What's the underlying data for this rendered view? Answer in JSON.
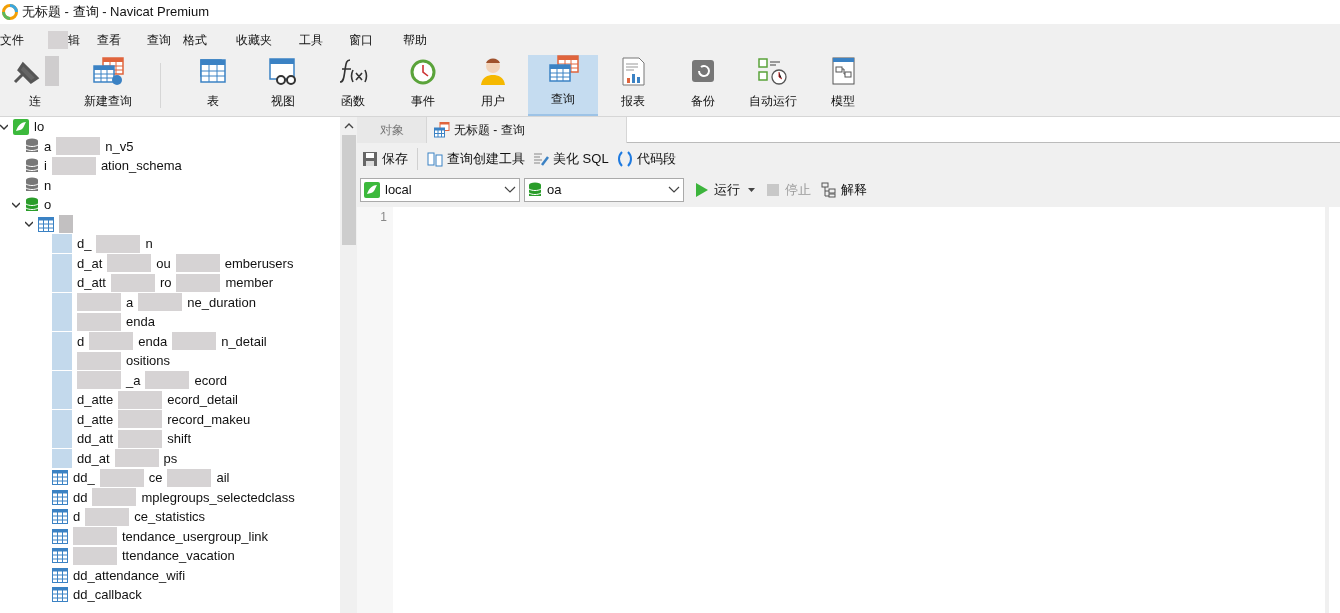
{
  "window": {
    "title": "无标题 - 查询 - Navicat Premium"
  },
  "menu": [
    {
      "parts": [
        "文件"
      ],
      "lead_mask": false
    },
    {
      "parts": [
        "辑"
      ],
      "lead_mask": true
    },
    {
      "parts": [
        "查看"
      ],
      "lead_mask": false
    },
    {
      "parts": [
        "查询"
      ],
      "lead_mask": false
    },
    {
      "parts": [
        "格式"
      ],
      "lead_mask": false
    },
    {
      "parts": [
        "收藏夹"
      ],
      "lead_mask": false
    },
    {
      "parts": [
        "工具"
      ],
      "lead_mask": false
    },
    {
      "parts": [
        "窗口"
      ],
      "lead_mask": false
    },
    {
      "parts": [
        "帮助"
      ],
      "lead_mask": false
    }
  ],
  "toolbar": [
    {
      "kind": "plug",
      "label": "连",
      "masked": true,
      "selected": false
    },
    {
      "kind": "newquery",
      "label": "新建查询",
      "masked": false,
      "selected": false
    },
    {
      "kind": "table",
      "label": "表",
      "masked": false,
      "selected": false
    },
    {
      "kind": "view",
      "label": "视图",
      "masked": false,
      "selected": false
    },
    {
      "kind": "function",
      "label": "函数",
      "masked": false,
      "selected": false
    },
    {
      "kind": "event",
      "label": "事件",
      "masked": false,
      "selected": false
    },
    {
      "kind": "user",
      "label": "用户",
      "masked": false,
      "selected": false
    },
    {
      "kind": "query",
      "label": "查询",
      "masked": false,
      "selected": true
    },
    {
      "kind": "report",
      "label": "报表",
      "masked": false,
      "selected": false
    },
    {
      "kind": "backup",
      "label": "备份",
      "masked": false,
      "selected": false
    },
    {
      "kind": "schedule",
      "label": "自动运行",
      "masked": false,
      "selected": false
    },
    {
      "kind": "model",
      "label": "模型",
      "masked": false,
      "selected": false
    }
  ],
  "tree": [
    {
      "kind": "connection",
      "parts": [
        "lo"
      ],
      "expanded": true,
      "children": [
        {
          "kind": "database",
          "parts": [
            "a",
            "n_v5"
          ],
          "active": false
        },
        {
          "kind": "database",
          "parts": [
            "i",
            "ation_schema"
          ],
          "active": false
        },
        {
          "kind": "database",
          "parts": [
            "n"
          ],
          "active": false
        },
        {
          "kind": "database",
          "parts": [
            "o"
          ],
          "active": true,
          "expanded": true,
          "children": [
            {
              "kind": "folder",
              "masked": true,
              "expanded": true,
              "children": [
                {
                  "kind": "table",
                  "masked": true,
                  "lead_mask": false,
                  "parts": [
                    "d_",
                    "n"
                  ]
                },
                {
                  "kind": "table",
                  "masked": true,
                  "lead_mask": false,
                  "parts": [
                    "d_at",
                    "ou",
                    "emberusers"
                  ]
                },
                {
                  "kind": "table",
                  "masked": true,
                  "lead_mask": false,
                  "parts": [
                    "d_att",
                    "ro",
                    "member"
                  ]
                },
                {
                  "kind": "table",
                  "masked": true,
                  "lead_mask": true,
                  "parts": [
                    "a",
                    "ne_duration"
                  ]
                },
                {
                  "kind": "table",
                  "masked": true,
                  "lead_mask": true,
                  "parts": [
                    "enda"
                  ]
                },
                {
                  "kind": "table",
                  "masked": true,
                  "lead_mask": false,
                  "parts": [
                    "d",
                    "enda",
                    "n_detail"
                  ]
                },
                {
                  "kind": "table",
                  "masked": true,
                  "lead_mask": true,
                  "parts": [
                    "ositions"
                  ]
                },
                {
                  "kind": "table",
                  "masked": true,
                  "lead_mask": true,
                  "parts": [
                    "_a",
                    "ecord"
                  ]
                },
                {
                  "kind": "table",
                  "masked": true,
                  "lead_mask": false,
                  "parts": [
                    "d_atte",
                    "ecord_detail"
                  ]
                },
                {
                  "kind": "table",
                  "masked": true,
                  "lead_mask": false,
                  "parts": [
                    "d_atte",
                    "record_makeu"
                  ]
                },
                {
                  "kind": "table",
                  "masked": true,
                  "lead_mask": false,
                  "parts": [
                    "dd_att",
                    "shift"
                  ]
                },
                {
                  "kind": "table",
                  "masked": true,
                  "lead_mask": false,
                  "parts": [
                    "dd_at",
                    "ps"
                  ]
                },
                {
                  "kind": "table",
                  "masked": false,
                  "lead_mask": false,
                  "parts": [
                    "dd_",
                    "ce",
                    "ail"
                  ]
                },
                {
                  "kind": "table",
                  "masked": false,
                  "lead_mask": false,
                  "parts": [
                    "dd",
                    "mplegroups_selectedclass"
                  ]
                },
                {
                  "kind": "table",
                  "masked": false,
                  "lead_mask": false,
                  "parts": [
                    "d",
                    "ce_statistics"
                  ]
                },
                {
                  "kind": "table",
                  "masked": false,
                  "lead_mask": true,
                  "parts": [
                    "tendance_usergroup_link"
                  ]
                },
                {
                  "kind": "table",
                  "masked": false,
                  "lead_mask": true,
                  "parts": [
                    "ttendance_vacation"
                  ]
                },
                {
                  "kind": "table",
                  "masked": false,
                  "lead_mask": false,
                  "parts": [
                    "dd_attendance_wifi"
                  ]
                },
                {
                  "kind": "table",
                  "masked": false,
                  "lead_mask": false,
                  "parts": [
                    "dd_callback"
                  ]
                }
              ]
            }
          ]
        }
      ]
    }
  ],
  "tabs": [
    {
      "label": "对象",
      "kind": "plain",
      "selected": false
    },
    {
      "label": "无标题 - 查询",
      "kind": "query",
      "selected": true
    }
  ],
  "query_toolbar": [
    {
      "kind": "save",
      "label": "保存"
    },
    {
      "kind": "builder",
      "label": "查询创建工具"
    },
    {
      "kind": "beautify",
      "label": "美化 SQL"
    },
    {
      "kind": "snippet",
      "label": "代码段"
    }
  ],
  "connection_select": {
    "value": "local"
  },
  "database_select": {
    "value": "oa"
  },
  "actions": [
    {
      "kind": "run",
      "label": "运行",
      "disabled": false
    },
    {
      "kind": "stop",
      "label": "停止",
      "disabled": true
    },
    {
      "kind": "explain",
      "label": "解释",
      "disabled": false
    }
  ],
  "editor": {
    "line_numbers": [
      "1"
    ]
  }
}
